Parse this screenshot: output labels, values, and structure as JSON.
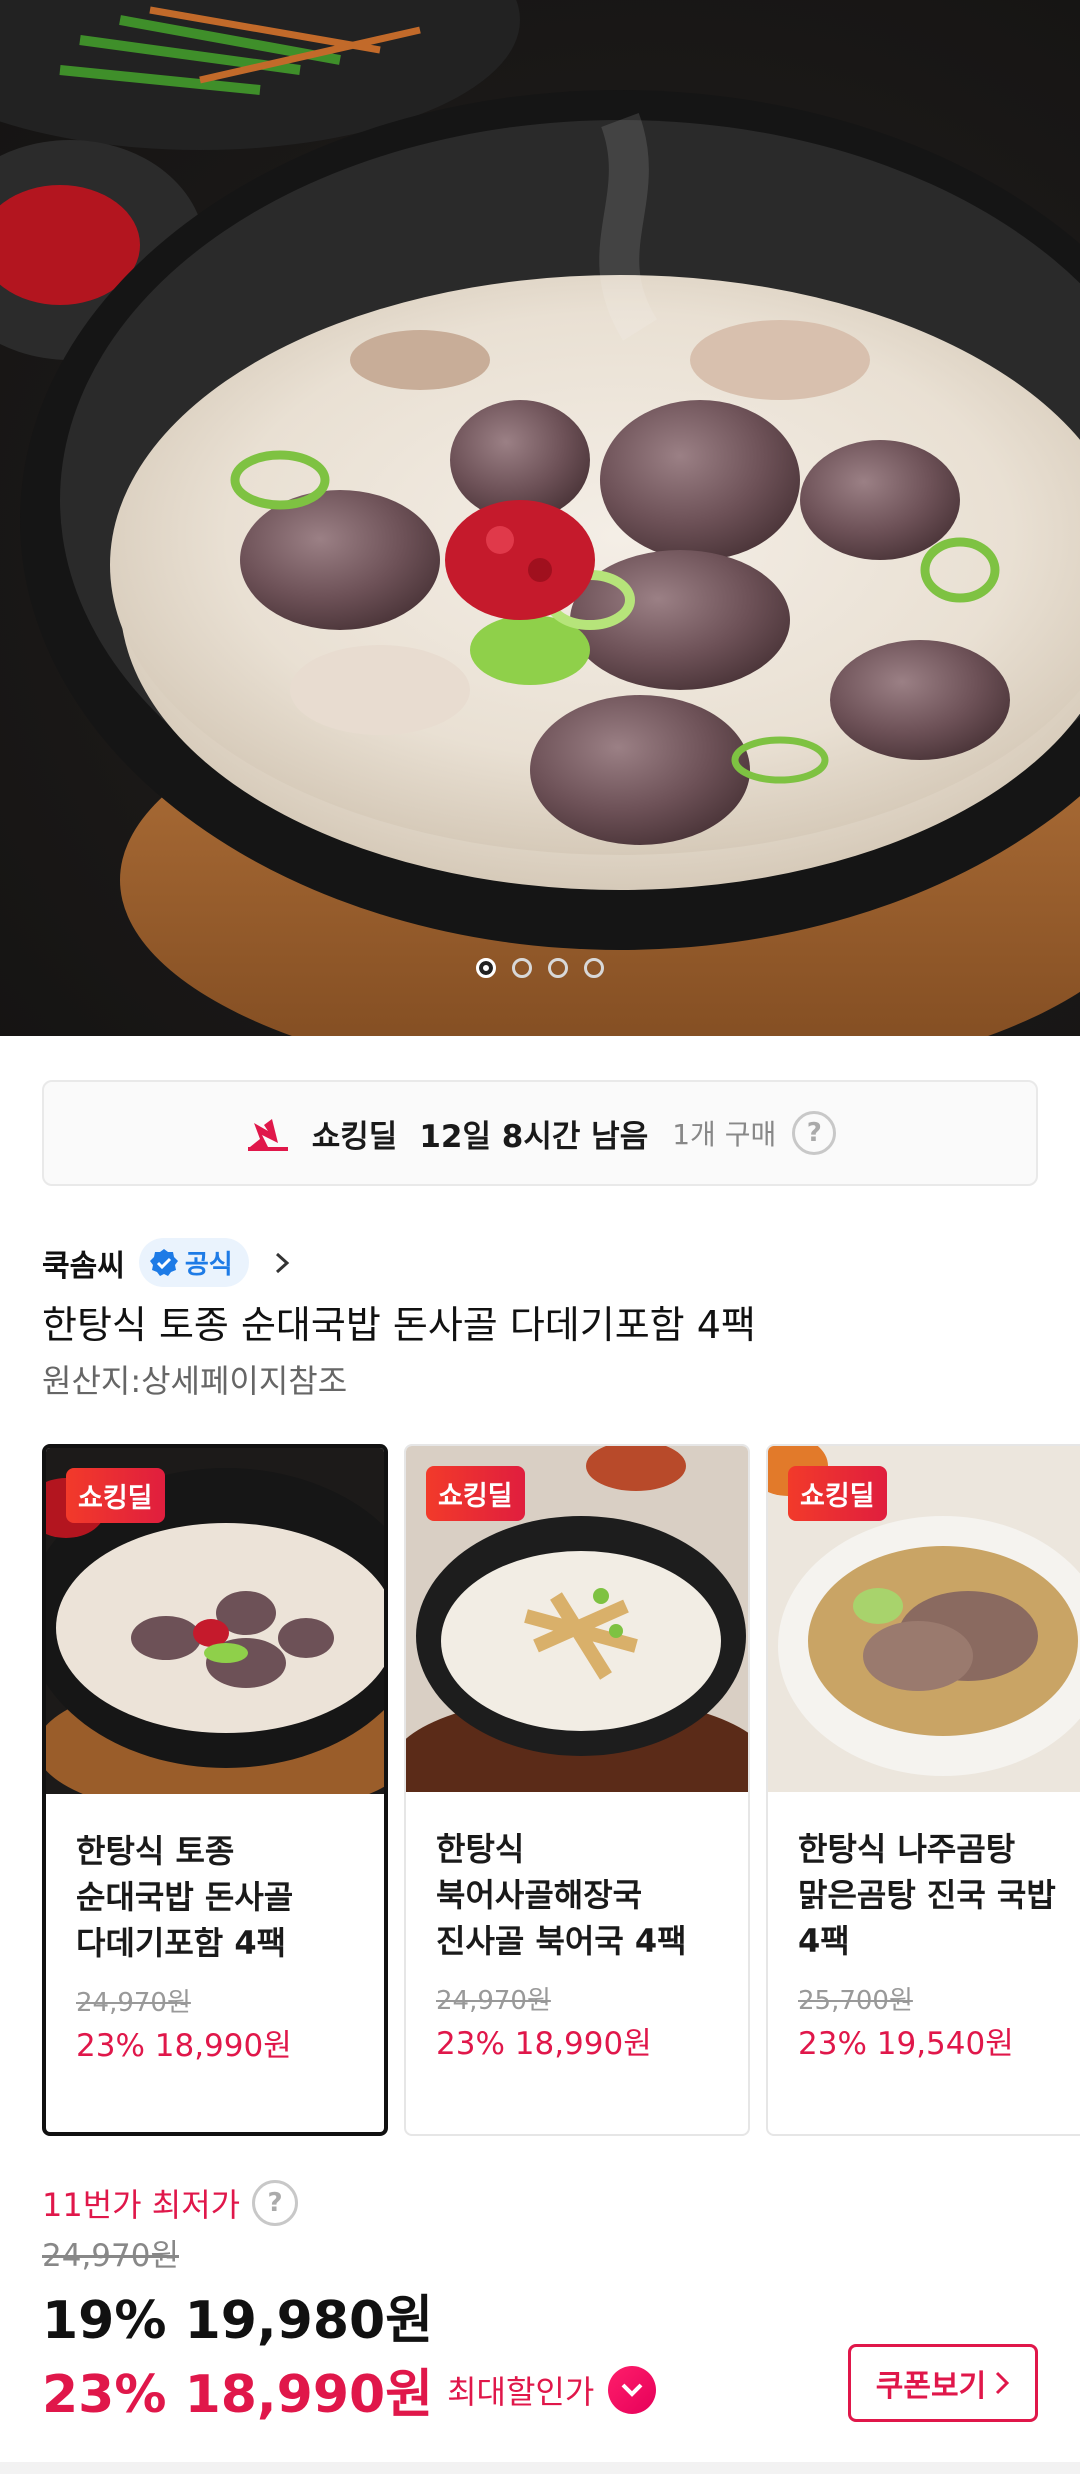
{
  "hero": {
    "slides_total": 4,
    "active_slide": 1
  },
  "deal_banner": {
    "label": "쇼킹딜",
    "time_left": "12일 8시간 남음",
    "purchase_count": "1개 구매",
    "help": "?"
  },
  "seller": {
    "name": "쿡솜씨",
    "badge": "공식"
  },
  "product": {
    "title": "한탕식 토종 순대국밥 돈사골 다데기포함 4팩",
    "origin": "원산지:상세페이지참조"
  },
  "deal_cards": [
    {
      "badge": "쇼킹딜",
      "name": "한탕식 토종\n순대국밥 돈사골\n다데기포함 4팩",
      "original_price": "24,970원",
      "price": "23% 18,990원",
      "selected": true
    },
    {
      "badge": "쇼킹딜",
      "name": "한탕식\n북어사골해장국\n진사골 북어국 4팩",
      "original_price": "24,970원",
      "price": "23% 18,990원",
      "selected": false
    },
    {
      "badge": "쇼킹딜",
      "name": "한탕식 나주곰탕\n맑은곰탕 진국 국밥\n4팩",
      "original_price": "25,700원",
      "price": "23% 19,540원",
      "selected": false
    }
  ],
  "pricing": {
    "lowest_label": "11번가 최저가",
    "help": "?",
    "original_price": "24,970원",
    "sale_price": "19% 19,980원",
    "final_price": "23% 18,990원",
    "max_discount_label": "최대할인가",
    "coupon_button": "쿠폰보기"
  },
  "colors": {
    "accent": "#e0174a",
    "official_blue": "#1e7be6"
  }
}
